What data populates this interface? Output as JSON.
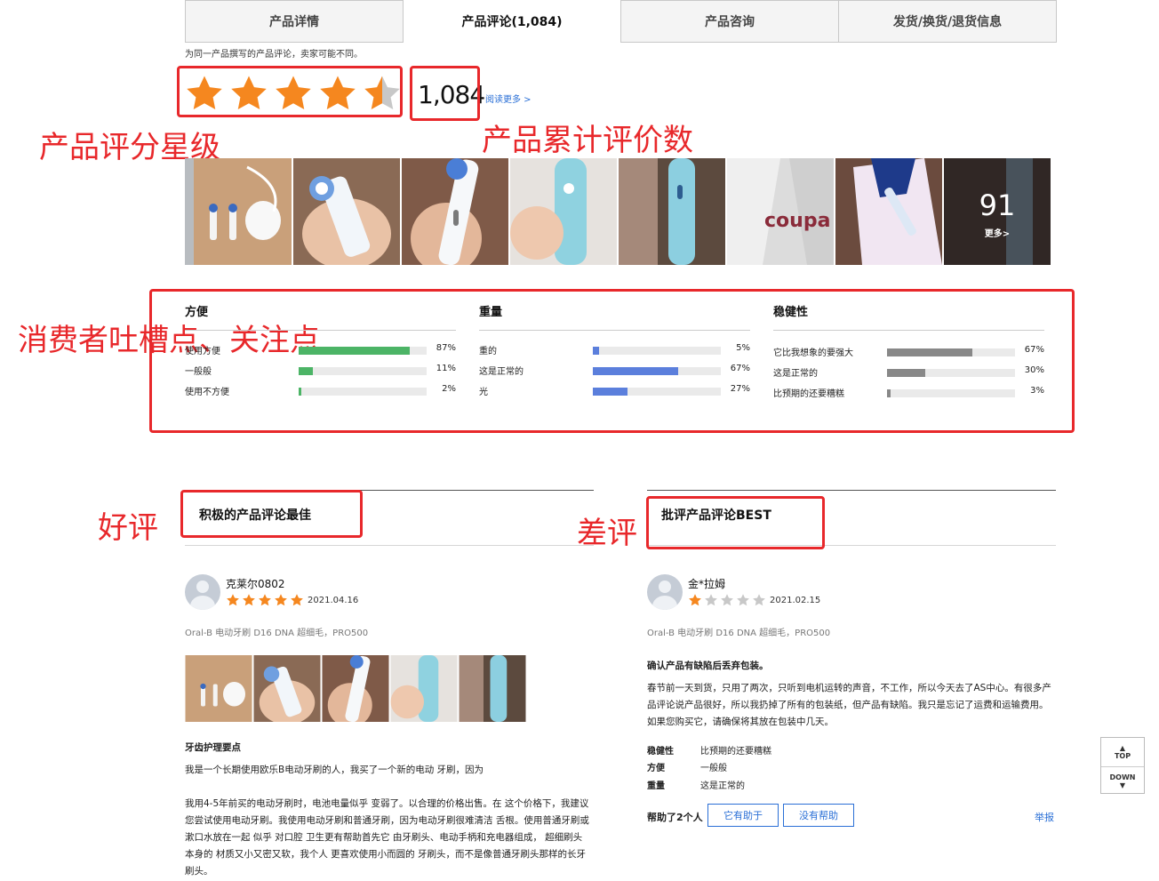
{
  "tabs": [
    {
      "label": "产品详情"
    },
    {
      "label": "产品评论(1,084)"
    },
    {
      "label": "产品咨询"
    },
    {
      "label": "发货/换货/退货信息"
    }
  ],
  "notice": "为同一产品撰写的产品评论，卖家可能不同。",
  "rating": {
    "stars": 4.5,
    "count": "1,084",
    "read_more": "阅读更多 >"
  },
  "annotations": {
    "rating": "产品评分星级",
    "count": "产品累计评价数",
    "attrs": "消费者吐槽点、关注点",
    "positive": "好评",
    "negative": "差评"
  },
  "photos": {
    "more_count": "91",
    "more_label": "更多>",
    "brand_text": "coupa"
  },
  "attributes": [
    {
      "title": "方便",
      "color": "#4cb466",
      "rows": [
        {
          "label": "使用方便",
          "value": 87,
          "pct": "87%"
        },
        {
          "label": "一般般",
          "value": 11,
          "pct": "11%"
        },
        {
          "label": "使用不方便",
          "value": 2,
          "pct": "2%"
        }
      ]
    },
    {
      "title": "重量",
      "color": "#5b7fdc",
      "rows": [
        {
          "label": "重的",
          "value": 5,
          "pct": "5%"
        },
        {
          "label": "这是正常的",
          "value": 67,
          "pct": "67%"
        },
        {
          "label": "光",
          "value": 27,
          "pct": "27%"
        }
      ]
    },
    {
      "title": "稳健性",
      "color": "#888888",
      "rows": [
        {
          "label": "它比我想象的要强大",
          "value": 67,
          "pct": "67%"
        },
        {
          "label": "这是正常的",
          "value": 30,
          "pct": "30%"
        },
        {
          "label": "比预期的还要糟糕",
          "value": 3,
          "pct": "3%"
        }
      ]
    }
  ],
  "positive": {
    "section_title": "积极的产品评论最佳",
    "reviewer": "克莱尔0802",
    "stars": 5,
    "date": "2021.04.16",
    "product": "Oral-B 电动牙刷 D16 DNA 超细毛，PRO500",
    "heading": "牙齿护理要点",
    "line1": "我是一个长期使用欧乐B电动牙刷的人，我买了一个新的电动 牙刷，因为",
    "body": "我用4-5年前买的电动牙刷时，电池电量似乎 变弱了。以合理的价格出售。在 这个价格下，我建议您尝试使用电动牙刷。我使用电动牙刷和普通牙刷，因为电动牙刷很难清洁 舌根。使用普通牙刷或漱口水放在一起 似乎 对口腔 卫生更有帮助首先它 由牙刷头、电动手柄和充电器组成， 超细刷头本身的 材质又小又密又软，我个人 更喜欢使用小而圆的 牙刷头，而不是像普通牙刷头那样的长牙刷头。"
  },
  "negative": {
    "section_title": "批评产品评论BEST",
    "reviewer": "金*拉姆",
    "stars": 1,
    "date": "2021.02.15",
    "product": "Oral-B 电动牙刷 D16 DNA 超细毛，PRO500",
    "heading": "确认产品有缺陷后丢弃包装。",
    "body": "春节前一天到货，只用了两次，只听到电机运转的声音，不工作，所以今天去了AS中心。有很多产品评论说产品很好，所以我扔掉了所有的包装纸，但产品有缺陷。我只是忘记了运费和运输费用。如果您购买它，请确保将其放在包装中几天。",
    "attrs": [
      {
        "k": "稳健性",
        "v": "比预期的还要糟糕"
      },
      {
        "k": "方便",
        "v": "一般般"
      },
      {
        "k": "重量",
        "v": "这是正常的"
      }
    ],
    "helpful_text": "帮助了2个人",
    "helpful_btn": "它有助于",
    "unhelpful_btn": "没有帮助",
    "report": "举报"
  },
  "floatnav": {
    "top": "TOP",
    "down": "DOWN"
  },
  "colors": {
    "star": "#f5871f",
    "star_empty": "#c8c8c8",
    "annotation": "#e8282b",
    "link": "#2a6fd6"
  }
}
